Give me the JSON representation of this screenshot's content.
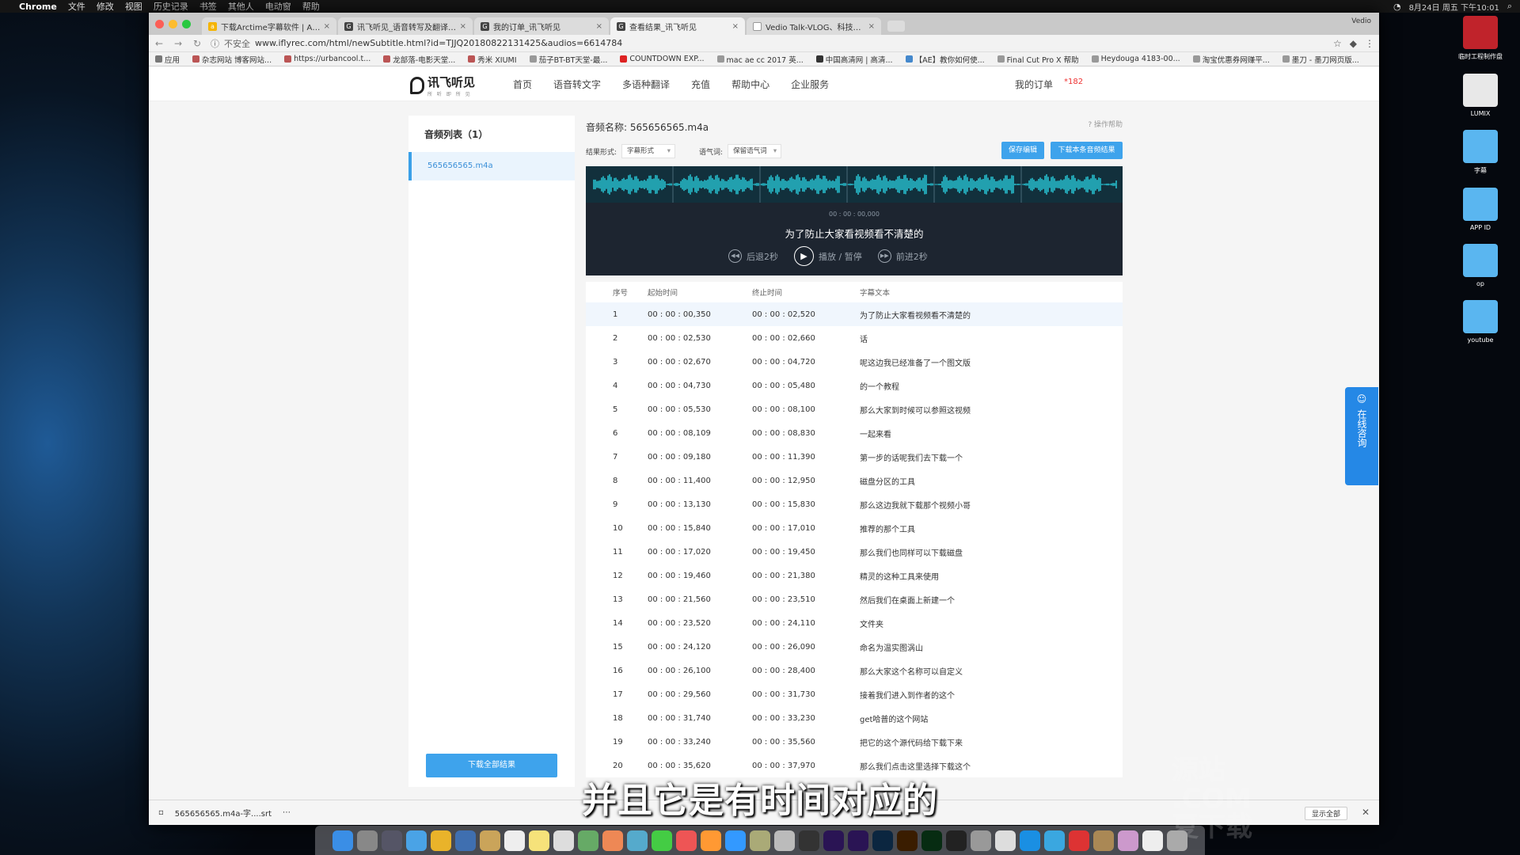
{
  "menubar": {
    "app": "Chrome",
    "items": [
      "文件",
      "修改",
      "视图",
      "历史记录",
      "书签",
      "其他人",
      "电动窗",
      "帮助"
    ],
    "status": "8月24日 周五 下午10:01"
  },
  "browser": {
    "tabs": [
      {
        "label": "下载Arctime字幕软件 | Arctime"
      },
      {
        "label": "讯飞听见_语音转写及翻译平台"
      },
      {
        "label": "我的订单_讯飞听见"
      },
      {
        "label": "查看结果_讯飞听见"
      },
      {
        "label": "Vedio Talk-VLOG、科技、生活"
      }
    ],
    "corner_label": "Vedio",
    "secure_label": "不安全",
    "url": "www.iflyrec.com/html/newSubtitle.html?id=TJJQ20180822131425&audios=6614784",
    "bookmarks": [
      "应用",
      "杂志网站 博客网站...",
      "https://urbancool.t...",
      "龙部落-电影天堂...",
      "秀米 XIUMI",
      "茄子BT-BT天堂-最...",
      "COUNTDOWN EXP...",
      "mac ae cc 2017 英...",
      "中国高清网 | 高清...",
      "【AE】教你如何使...",
      "Final Cut Pro X 帮助",
      "Heydouga 4183-00...",
      "淘宝优惠券网赚平...",
      "墨刀 - 墨刀网页版..."
    ]
  },
  "site": {
    "logo": "讯飞听见",
    "logo_sub": "所 听 即 所 见",
    "nav": [
      "首页",
      "语音转文字",
      "多语种翻译",
      "充值",
      "帮助中心",
      "企业服务"
    ],
    "my_orders": "我的订单",
    "phone": "*182"
  },
  "sidebar": {
    "title": "音频列表（1）",
    "file": "565656565.m4a",
    "download_all": "下载全部结果"
  },
  "main": {
    "filename_label": "音频名称:",
    "filename": "565656565.m4a",
    "help": "操作帮助",
    "result_form_label": "结果形式:",
    "result_form_value": "字幕形式",
    "tone_label": "语气词:",
    "tone_value": "保留语气词",
    "save_btn": "保存编辑",
    "download_btn": "下载本条音频结果",
    "player": {
      "time": "00 : 00 : 00,000",
      "current_text": "为了防止大家看视频看不清楚的",
      "back": "后退2秒",
      "play": "播放 / 暂停",
      "forward": "前进2秒"
    },
    "table": {
      "headers": [
        "序号",
        "起始时间",
        "终止时间",
        "字幕文本"
      ],
      "rows": [
        [
          "1",
          "00 : 00 : 00,350",
          "00 : 00 : 02,520",
          "为了防止大家看视频看不清楚的"
        ],
        [
          "2",
          "00 : 00 : 02,530",
          "00 : 00 : 02,660",
          "话"
        ],
        [
          "3",
          "00 : 00 : 02,670",
          "00 : 00 : 04,720",
          "呢这边我已经准备了一个图文版"
        ],
        [
          "4",
          "00 : 00 : 04,730",
          "00 : 00 : 05,480",
          "的一个教程"
        ],
        [
          "5",
          "00 : 00 : 05,530",
          "00 : 00 : 08,100",
          "那么大家到时候可以参照这视频"
        ],
        [
          "6",
          "00 : 00 : 08,109",
          "00 : 00 : 08,830",
          "一起来看"
        ],
        [
          "7",
          "00 : 00 : 09,180",
          "00 : 00 : 11,390",
          "第一步的话呢我们去下载一个"
        ],
        [
          "8",
          "00 : 00 : 11,400",
          "00 : 00 : 12,950",
          "磁盘分区的工具"
        ],
        [
          "9",
          "00 : 00 : 13,130",
          "00 : 00 : 15,830",
          "那么这边我就下载那个视频小哥"
        ],
        [
          "10",
          "00 : 00 : 15,840",
          "00 : 00 : 17,010",
          "推荐的那个工具"
        ],
        [
          "11",
          "00 : 00 : 17,020",
          "00 : 00 : 19,450",
          "那么我们也同样可以下载磁盘"
        ],
        [
          "12",
          "00 : 00 : 19,460",
          "00 : 00 : 21,380",
          "精灵的这种工具来使用"
        ],
        [
          "13",
          "00 : 00 : 21,560",
          "00 : 00 : 23,510",
          "然后我们在桌面上新建一个"
        ],
        [
          "14",
          "00 : 00 : 23,520",
          "00 : 00 : 24,110",
          "文件夹"
        ],
        [
          "15",
          "00 : 00 : 24,120",
          "00 : 00 : 26,090",
          "命名为温实图涡山"
        ],
        [
          "16",
          "00 : 00 : 26,100",
          "00 : 00 : 28,400",
          "那么大家这个名称可以自定义"
        ],
        [
          "17",
          "00 : 00 : 29,560",
          "00 : 00 : 31,730",
          "接着我们进入到作者的这个"
        ],
        [
          "18",
          "00 : 00 : 31,740",
          "00 : 00 : 33,230",
          "get哈普的这个网站"
        ],
        [
          "19",
          "00 : 00 : 33,240",
          "00 : 00 : 35,560",
          "把它的这个源代码给下载下来"
        ],
        [
          "20",
          "00 : 00 : 35,620",
          "00 : 00 : 37,970",
          "那么我们点击这里选择下载这个"
        ]
      ]
    }
  },
  "downloads": {
    "file": "565656565.m4a-字....srt",
    "more": "⋯",
    "show_all": "显示全部",
    "close": "✕"
  },
  "float": {
    "text": "在线咨询"
  },
  "subtitle": "并且它是有时间对应的",
  "watermark": "源站\n.COM\n夏下载",
  "desktop": [
    "临时工程制作盘",
    "LUMIX",
    "字幕",
    "APP ID",
    "op",
    "youtube"
  ],
  "colors": {
    "accent": "#3ea3ec",
    "player_bg": "#1d2530",
    "wave": "#2ad0e0"
  }
}
